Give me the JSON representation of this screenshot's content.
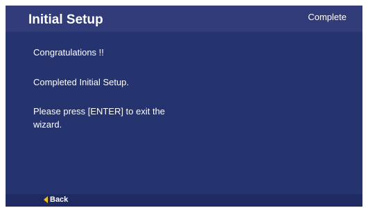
{
  "header": {
    "title": "Initial Setup",
    "status": "Complete"
  },
  "content": {
    "line1": "Congratulations !!",
    "line2": "Completed Initial Setup.",
    "line3": "Please press [ENTER] to exit the wizard."
  },
  "footer": {
    "back_label": "Back",
    "back_icon": "left-arrow-icon"
  },
  "colors": {
    "screen_background": "#25336e",
    "header_background": "#323c78",
    "footer_background": "#202a62",
    "accent": "#f2c216",
    "text": "#ffffff"
  }
}
